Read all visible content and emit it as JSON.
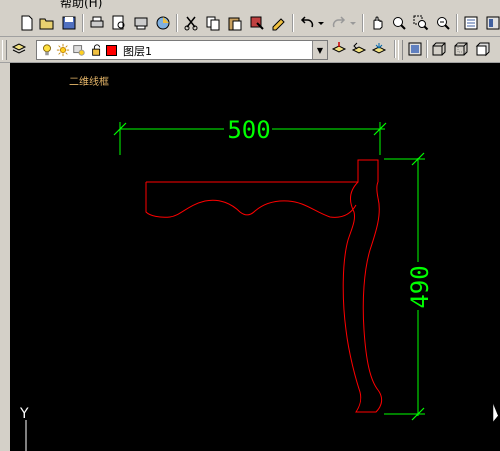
{
  "menu": {
    "help_label": "帮助(H)"
  },
  "layer": {
    "name": "图层1",
    "color": "#ff0000"
  },
  "viewport": {
    "label": "二维线框"
  },
  "drawing": {
    "width_dim": "500",
    "height_dim": "490",
    "dim_color": "#00ff00",
    "outline_color": "#ff0000"
  },
  "ucs": {
    "y_label": "Y"
  }
}
